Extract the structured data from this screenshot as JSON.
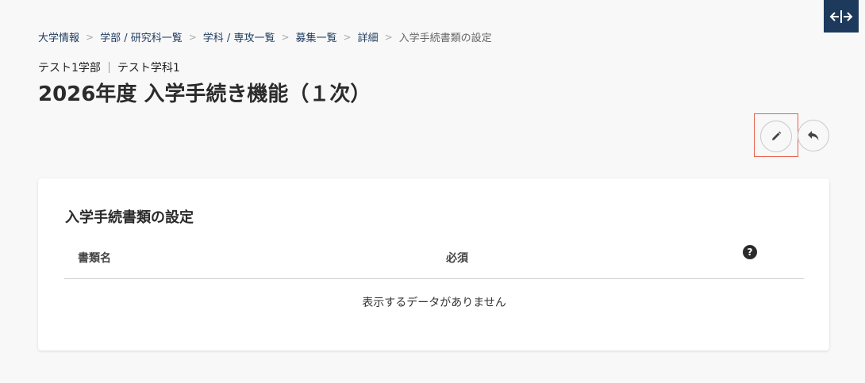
{
  "breadcrumb": {
    "items": [
      "大学情報",
      "学部 / 研究科一覧",
      "学科 / 専攻一覧",
      "募集一覧",
      "詳細"
    ],
    "current": "入学手続書類の設定",
    "separator": ">"
  },
  "header": {
    "faculty": "テスト1学部",
    "department": "テスト学科1",
    "title": "2026年度 入学手続き機能（１次）"
  },
  "actions": {
    "edit_icon": "pencil-icon",
    "back_icon": "reply-arrow-icon",
    "expand_icon": "expand-horizontal-icon"
  },
  "card": {
    "title": "入学手続書類の設定",
    "columns": {
      "name": "書類名",
      "required": "必須",
      "help": "?"
    },
    "empty_message": "表示するデータがありません"
  },
  "colors": {
    "brand": "#1d3a5c",
    "highlight": "#e8604a"
  }
}
